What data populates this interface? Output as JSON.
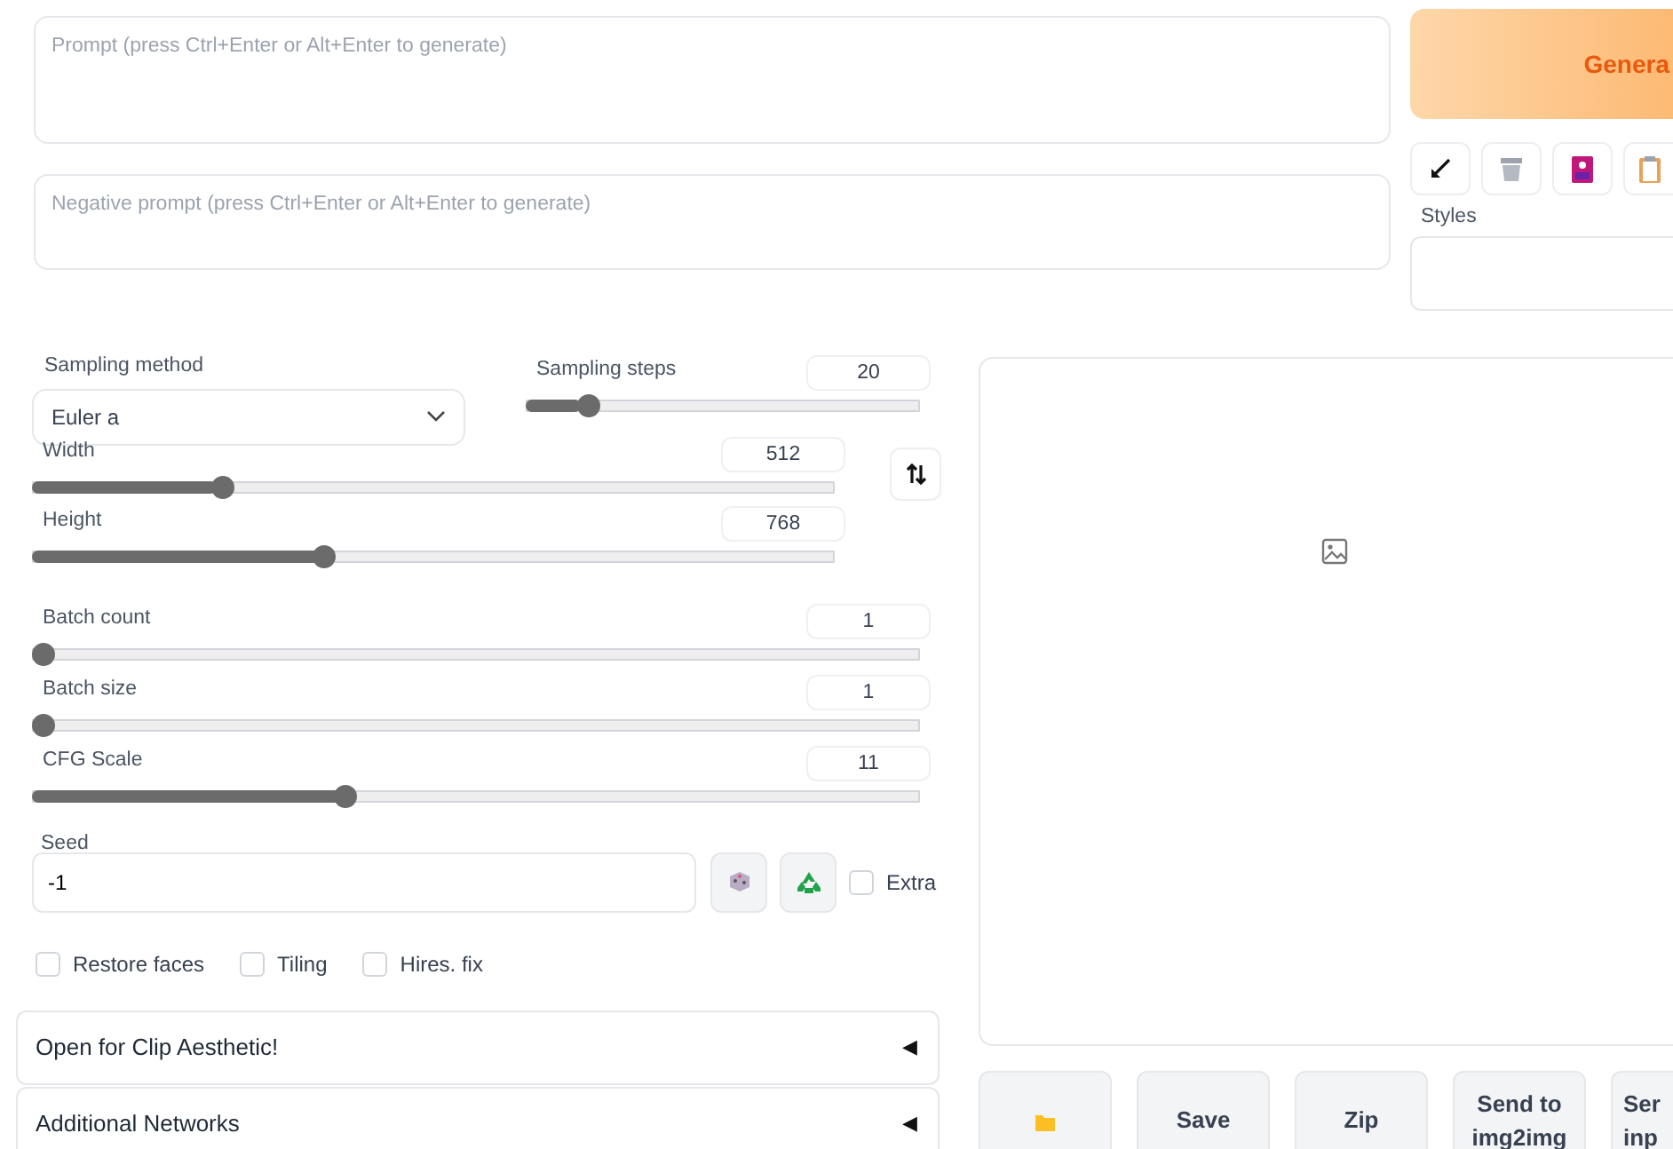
{
  "prompt": {
    "placeholder": "Prompt (press Ctrl+Enter or Alt+Enter to generate)"
  },
  "negative_prompt": {
    "placeholder": "Negative prompt (press Ctrl+Enter or Alt+Enter to generate)"
  },
  "generate_button": "Genera",
  "styles": {
    "label": "Styles"
  },
  "sampling_method": {
    "label": "Sampling method",
    "value": "Euler a"
  },
  "sliders": [
    {
      "label": "Sampling steps",
      "value": "20",
      "level": 0.14
    },
    {
      "label": "Width",
      "value": "512",
      "level": 0.23
    },
    {
      "label": "Height",
      "value": "768",
      "level": 0.36
    },
    {
      "label": "Batch count",
      "value": "1",
      "level": 0
    },
    {
      "label": "Batch size",
      "value": "1",
      "level": 0
    },
    {
      "label": "CFG Scale",
      "value": "11",
      "level": 0.35
    }
  ],
  "seed": {
    "label": "Seed",
    "value": "-1"
  },
  "extra": {
    "label": "Extra",
    "checked": false
  },
  "options": [
    {
      "label": "Restore faces",
      "checked": false
    },
    {
      "label": "Tiling",
      "checked": false
    },
    {
      "label": "Hires. fix",
      "checked": false
    }
  ],
  "accordions": [
    {
      "title": "Open for Clip Aesthetic!",
      "arrow": "◀"
    },
    {
      "title": "Additional Networks",
      "arrow": "◀"
    }
  ],
  "output_buttons": [
    {
      "kind": "folder"
    },
    {
      "kind": "text",
      "label": "Save"
    },
    {
      "kind": "text",
      "label": "Zip"
    },
    {
      "kind": "text",
      "label": "Send to img2img"
    },
    {
      "kind": "cut",
      "label": "Ser inp"
    }
  ]
}
